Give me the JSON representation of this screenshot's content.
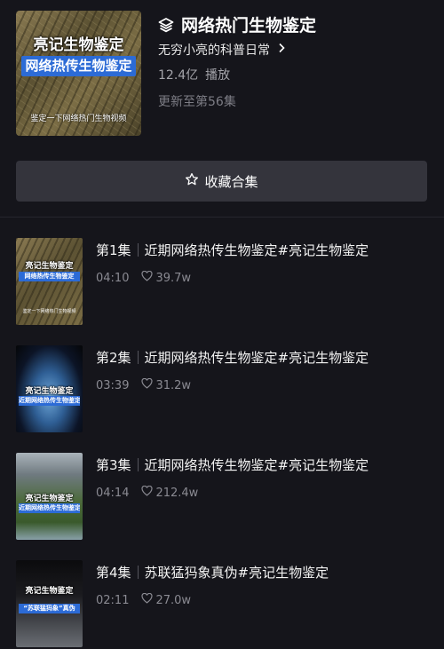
{
  "collection": {
    "title": "网络热门生物鉴定",
    "author": "无穷小亮的科普日常",
    "play_count": "12.4亿",
    "play_label": "播放",
    "update_status": "更新至第56集",
    "cover": {
      "line1": "亮记生物鉴定",
      "line2": "网络热传生物鉴定",
      "line3": "鉴定一下网络热门生物视频"
    }
  },
  "collect_button": {
    "label": "收藏合集"
  },
  "episodes": [
    {
      "number": "第1集",
      "title": "近期网络热传生物鉴定#亮记生物鉴定",
      "duration": "04:10",
      "likes": "39.7w",
      "thumb": {
        "line1": "亮记生物鉴定",
        "line2": "网络热传生物鉴定",
        "line3": "鉴定一下网络热门生物视频"
      }
    },
    {
      "number": "第2集",
      "title": "近期网络热传生物鉴定#亮记生物鉴定",
      "duration": "03:39",
      "likes": "31.2w",
      "thumb": {
        "line1": "亮记生物鉴定",
        "line2": "近期网络热传生物鉴定"
      }
    },
    {
      "number": "第3集",
      "title": "近期网络热传生物鉴定#亮记生物鉴定",
      "duration": "04:14",
      "likes": "212.4w",
      "thumb": {
        "line1": "亮记生物鉴定",
        "line2": "近期网络热传生物鉴定"
      }
    },
    {
      "number": "第4集",
      "title": "苏联猛犸象真伪#亮记生物鉴定",
      "duration": "02:11",
      "likes": "27.0w",
      "thumb": {
        "line1": "亮记生物鉴定",
        "line2": "“苏联猛犸象”真伪"
      }
    }
  ],
  "icons": {
    "layers": "layers-icon",
    "chevron": "chevron-right-icon",
    "star": "star-outline-icon",
    "heart": "heart-outline-icon"
  }
}
